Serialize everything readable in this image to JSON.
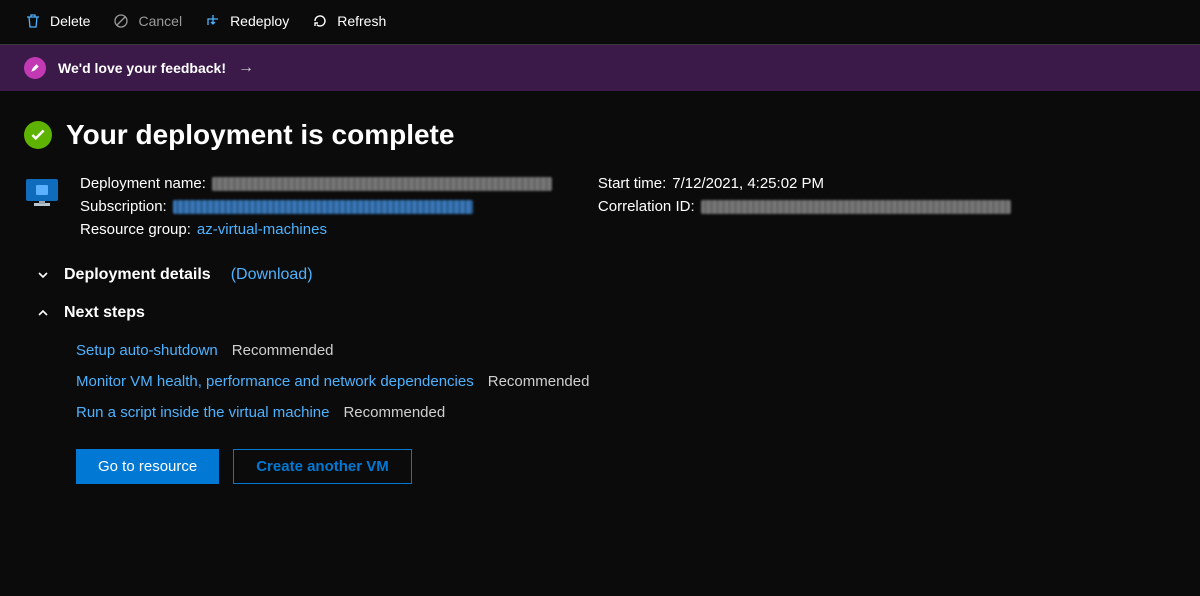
{
  "toolbar": {
    "delete": "Delete",
    "cancel": "Cancel",
    "redeploy": "Redeploy",
    "refresh": "Refresh"
  },
  "banner": {
    "text": "We'd love your feedback!"
  },
  "heading": "Your deployment is complete",
  "overview": {
    "deployment_name_label": "Deployment name:",
    "subscription_label": "Subscription:",
    "resource_group_label": "Resource group:",
    "resource_group_value": "az-virtual-machines",
    "start_time_label": "Start time:",
    "start_time_value": "7/12/2021, 4:25:02 PM",
    "correlation_id_label": "Correlation ID:"
  },
  "sections": {
    "deployment_details": "Deployment details",
    "download": "(Download)",
    "next_steps": "Next steps"
  },
  "next_steps": [
    {
      "link": "Setup auto-shutdown",
      "hint": "Recommended"
    },
    {
      "link": "Monitor VM health, performance and network dependencies",
      "hint": "Recommended"
    },
    {
      "link": "Run a script inside the virtual machine",
      "hint": "Recommended"
    }
  ],
  "buttons": {
    "go_to_resource": "Go to resource",
    "create_another": "Create another VM"
  }
}
